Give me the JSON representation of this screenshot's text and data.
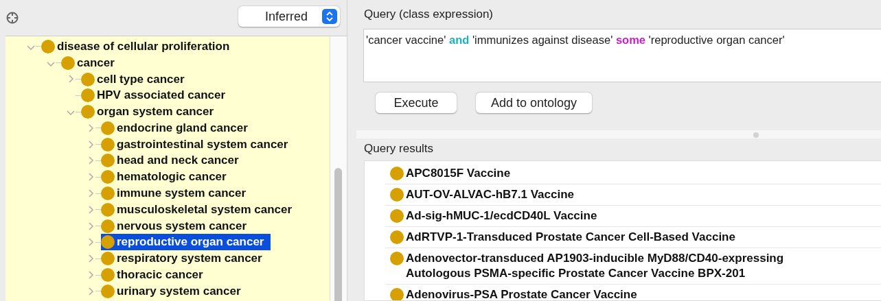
{
  "hierarchy_panel": {
    "mode_select": {
      "value": "Inferred"
    },
    "tree": [
      {
        "label": "disease of cellular proliferation",
        "kind": "branch",
        "expanded": true,
        "selected": false,
        "children": [
          {
            "label": "cancer",
            "kind": "branch",
            "expanded": true,
            "selected": false,
            "children": [
              {
                "label": "cell type cancer",
                "kind": "branch",
                "expanded": false,
                "selected": false
              },
              {
                "label": "HPV associated cancer",
                "kind": "leaf",
                "selected": false
              },
              {
                "label": "organ system cancer",
                "kind": "branch",
                "expanded": true,
                "selected": false,
                "children": [
                  {
                    "label": "endocrine gland cancer",
                    "kind": "branch",
                    "expanded": false,
                    "selected": false
                  },
                  {
                    "label": "gastrointestinal system cancer",
                    "kind": "branch",
                    "expanded": false,
                    "selected": false
                  },
                  {
                    "label": "head and neck cancer",
                    "kind": "branch",
                    "expanded": false,
                    "selected": false
                  },
                  {
                    "label": "hematologic cancer",
                    "kind": "branch",
                    "expanded": false,
                    "selected": false
                  },
                  {
                    "label": "immune system cancer",
                    "kind": "branch",
                    "expanded": false,
                    "selected": false
                  },
                  {
                    "label": "musculoskeletal system cancer",
                    "kind": "branch",
                    "expanded": false,
                    "selected": false
                  },
                  {
                    "label": "nervous system cancer",
                    "kind": "branch",
                    "expanded": false,
                    "selected": false
                  },
                  {
                    "label": "reproductive organ cancer",
                    "kind": "branch",
                    "expanded": false,
                    "selected": true
                  },
                  {
                    "label": "respiratory system cancer",
                    "kind": "branch",
                    "expanded": false,
                    "selected": false
                  },
                  {
                    "label": "thoracic cancer",
                    "kind": "branch",
                    "expanded": false,
                    "selected": false
                  },
                  {
                    "label": "urinary system cancer",
                    "kind": "branch",
                    "expanded": false,
                    "selected": false
                  }
                ]
              }
            ]
          }
        ]
      }
    ]
  },
  "query_panel": {
    "title": "Query (class expression)",
    "expression": [
      {
        "text": "'cancer vaccine'",
        "kind": "plain"
      },
      {
        "text": "and",
        "kind": "keyword",
        "color": "#1cb4bc"
      },
      {
        "text": "'immunizes against disease'",
        "kind": "plain"
      },
      {
        "text": "some",
        "kind": "keyword",
        "color": "#c81ec8"
      },
      {
        "text": "'reproductive organ cancer'",
        "kind": "plain"
      }
    ],
    "buttons": [
      "Execute",
      "Add to ontology"
    ]
  },
  "results_panel": {
    "title": "Query results",
    "results": [
      "APC8015F Vaccine",
      "AUT-OV-ALVAC-hB7.1 Vaccine",
      "Ad-sig-hMUC-1/ecdCD40L Vaccine",
      "AdRTVP-1-Transduced Prostate Cancer Cell-Based Vaccine",
      "Adenovector-transduced AP1903-inducible MyD88/CD40-expressing Autologous PSMA-specific Prostate Cancer Vaccine BPX-201",
      "Adenovirus-PSA Prostate Cancer Vaccine"
    ]
  }
}
